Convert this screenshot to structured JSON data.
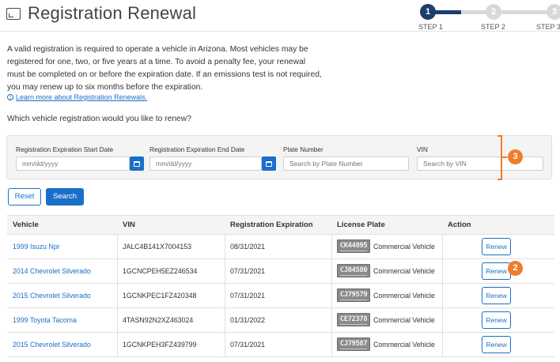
{
  "header": {
    "title": "Registration Renewal",
    "steps": [
      {
        "number": "1",
        "label": "STEP 1",
        "active": true
      },
      {
        "number": "2",
        "label": "STEP 2",
        "active": false
      },
      {
        "number": "3",
        "label": "STEP 3",
        "active": false
      }
    ]
  },
  "intro": {
    "text": "A valid registration is required to operate a vehicle in Arizona. Most vehicles may be registered for one, two, or five years at a time. To avoid a penalty fee, your renewal must be completed on or before the expiration date. If an emissions test is not required, you may renew up to six months before the expiration.",
    "learn_more_link": "Learn more about Registration Renewals.",
    "question": "Which vehicle registration would you like to renew?"
  },
  "filters": {
    "start_date_label": "Registration Expiration Start Date",
    "start_date_placeholder": "mm/dd/yyyy",
    "end_date_label": "Registration Expiration End Date",
    "end_date_placeholder": "mm/dd/yyyy",
    "plate_label": "Plate Number",
    "plate_placeholder": "Search by Plate Number",
    "vin_label": "VIN",
    "vin_placeholder": "Search by VIN",
    "reset_label": "Reset",
    "search_label": "Search"
  },
  "callouts": {
    "filter_callout": "3",
    "renew_callout": "2"
  },
  "table": {
    "columns": [
      "Vehicle",
      "VIN",
      "Registration Expiration",
      "License Plate",
      "Action"
    ],
    "rows": [
      {
        "vehicle": "1999 Isuzu Npr",
        "vin": "JALC4B141X7004153",
        "expiration": "08/31/2021",
        "plate": "CK44895",
        "plate_type": "Commercial Vehicle",
        "action": "Renew"
      },
      {
        "vehicle": "2014 Chevrolet Silverado",
        "vin": "1GCNCPEH5EZ246534",
        "expiration": "07/31/2021",
        "plate": "CJ84580",
        "plate_type": "Commercial Vehicle",
        "action": "Renew"
      },
      {
        "vehicle": "2015 Chevrolet Silverado",
        "vin": "1GCNKPEC1FZ420348",
        "expiration": "07/31/2021",
        "plate": "CJ79579",
        "plate_type": "Commercial Vehicle",
        "action": "Renew"
      },
      {
        "vehicle": "1999 Toyota Tacoma",
        "vin": "4TASN92N2XZ463024",
        "expiration": "01/31/2022",
        "plate": "CE72378",
        "plate_type": "Commercial Vehicle",
        "action": "Renew"
      },
      {
        "vehicle": "2015 Chevrolet Silverado",
        "vin": "1GCNKPEH3FZ439799",
        "expiration": "07/31/2021",
        "plate": "CJ79587",
        "plate_type": "Commercial Vehicle",
        "action": "Renew"
      }
    ]
  },
  "colors": {
    "accent": "#1a6fc9",
    "step_active": "#1d3d6e",
    "callout": "#f07c2a"
  }
}
